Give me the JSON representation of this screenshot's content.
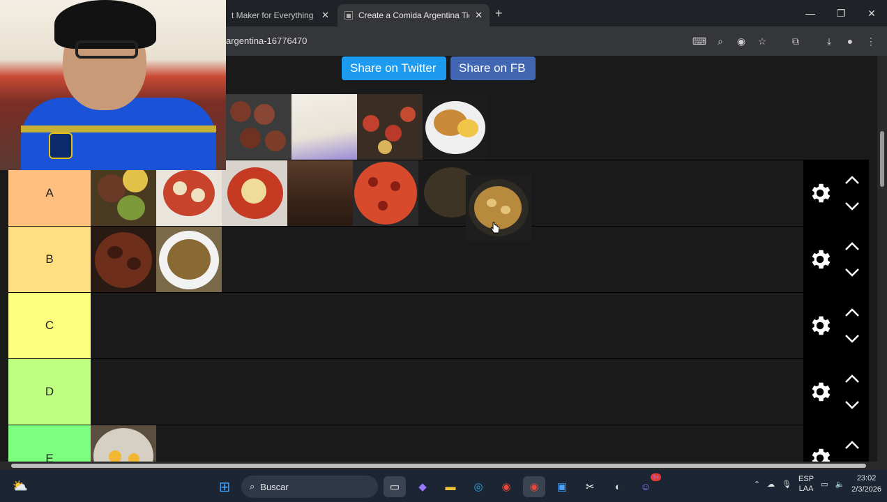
{
  "browser": {
    "tabs": [
      {
        "title": "t Maker for Everything -"
      },
      {
        "title": "Create a Comida Argentina Tie"
      }
    ],
    "new_tab": "+",
    "omnibox_text": "argentina-16776470",
    "window_controls": [
      "minimize",
      "restore",
      "close"
    ]
  },
  "page": {
    "share_twitter": "Share on Twitter",
    "share_fb": "Share on FB",
    "unranked_items": [
      "chorizo-grill",
      "sandwich-de-miga",
      "pizza-slices",
      "milanesa-con-papas"
    ],
    "tiers": [
      {
        "label": "A",
        "color": "#ffbf7f",
        "items": [
          "locro",
          "noquis",
          "ravioles",
          "chocotorta",
          "pizza",
          "guiso-dark"
        ]
      },
      {
        "label": "B",
        "color": "#ffdf7f",
        "items": [
          "estofado",
          "tallarines"
        ]
      },
      {
        "label": "C",
        "color": "#ffff7f",
        "items": []
      },
      {
        "label": "D",
        "color": "#bfff7f",
        "items": []
      },
      {
        "label": "E",
        "color": "#7fff7f",
        "items": [
          "huevos-fritos"
        ]
      }
    ],
    "dragging_item": "guiso-mondongo"
  },
  "taskbar": {
    "search_placeholder": "Buscar",
    "lang_line1": "ESP",
    "lang_line2": "LAA",
    "time": "23:02",
    "date": "2/3/2026",
    "notif_badge": "9+"
  }
}
